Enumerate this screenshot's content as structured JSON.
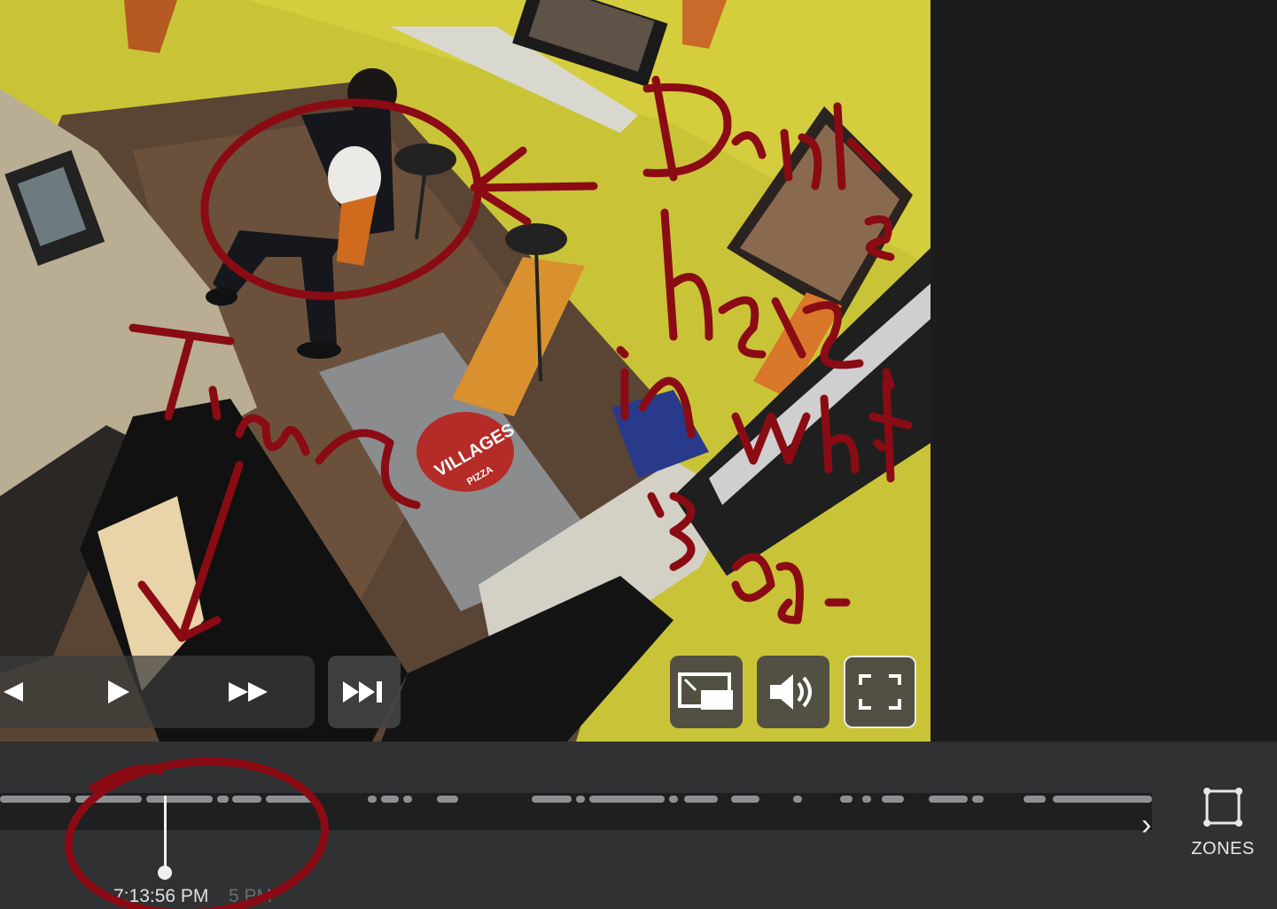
{
  "video": {
    "mat_logo_text": "VILLAGES",
    "mat_logo_sub": "PIZZA"
  },
  "controls": {
    "icons": [
      "play-icon",
      "fast-forward-icon",
      "skip-forward-icon",
      "picture-in-picture-icon",
      "volume-icon",
      "fullscreen-icon"
    ]
  },
  "timeline": {
    "current_time": "7:13:56 PM",
    "next_time_partial": "5 PM",
    "zones_label": "ZONES"
  },
  "annotations": {
    "color": "#8b0b14",
    "note_drinks": "Drinks here in white bag.",
    "note_time": "Time"
  }
}
